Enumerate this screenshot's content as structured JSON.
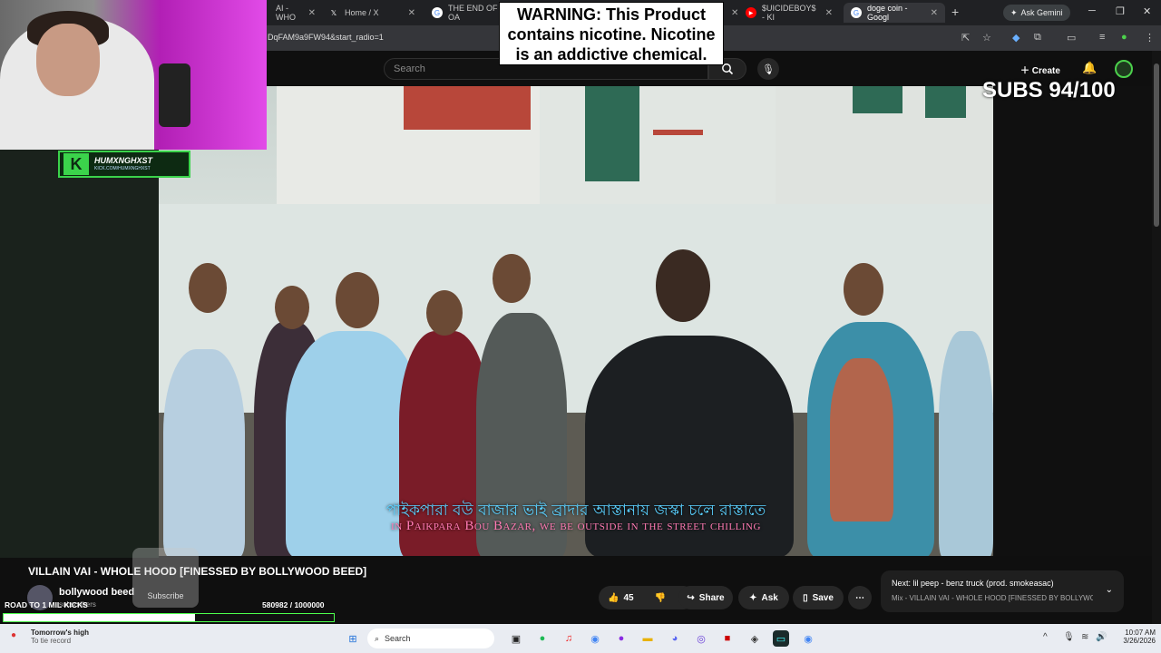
{
  "browser": {
    "tabs": [
      {
        "label": "AI - WHO",
        "icon": "youtube-icon",
        "active": false
      },
      {
        "label": "Home / X",
        "icon": "x-icon",
        "active": false
      },
      {
        "label": "THE END OF OA",
        "icon": "google-icon",
        "active": false
      },
      {
        "label": "$UICIDEBOY$ - KI",
        "icon": "youtube-icon",
        "active": false
      },
      {
        "label": "doge coin - Googl",
        "icon": "google-icon",
        "active": true
      }
    ],
    "ask_gemini": "Ask Gemini",
    "url": "DqFAM9a9FW94&start_radio=1"
  },
  "youtube": {
    "search_placeholder": "Search",
    "create_label": "Create"
  },
  "overlays": {
    "warning_text": "WARNING: This Product contains nicotine. Nicotine is an addictive chemical.",
    "subs_goal": "SUBS 94/100",
    "streamer_name": "HUMXNGHXST",
    "streamer_site": "KICK.COM/HUMXNGHXST",
    "road_label": "ROAD TO 1 MIL KICKS",
    "kick_count": "580982  / 1000000",
    "kick_progress_fraction": 0.581
  },
  "video": {
    "subtitle_bengali": "পাইকপারা বউ বাজার ভাই ব্রাদার আস্তানায়  জস্কা চলে রাস্তাতে",
    "subtitle_english": "in Paikpara Bou Bazar, we be outside in the street chilling",
    "title": "VILLAIN VAI - WHOLE HOOD [FINESSED BY BOLLYWOOD BEED]",
    "channel_name": "bollywood beed",
    "channel_subs": "subscribers",
    "subscribe_label": "Subscribe",
    "likes": "45",
    "share_label": "Share",
    "ask_label": "Ask",
    "save_label": "Save"
  },
  "up_next": {
    "title": "Next: lil peep - benz truck (prod. smokeasac)",
    "subtitle": "Mix - VILLAIN VAI - WHOLE HOOD [FINESSED BY BOLLYWOO..."
  },
  "taskbar": {
    "weather_title": "Tomorrow's high",
    "weather_sub": "To tie record",
    "search_label": "Search",
    "time": "10:07 AM",
    "date": "3/26/2026"
  }
}
